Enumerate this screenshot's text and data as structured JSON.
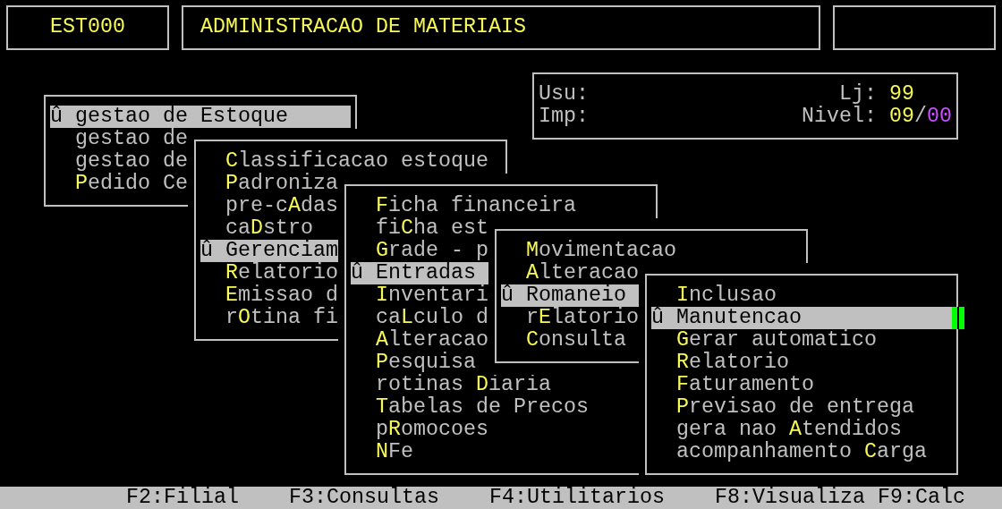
{
  "header": {
    "program_code": "EST000",
    "title": "ADMINISTRACAO DE MATERIAIS"
  },
  "session": {
    "user_label": "Usu:",
    "printer_label": "Imp:",
    "store_label": "Lj:",
    "store": "99",
    "level_label": "Nivel:",
    "level_main": "09",
    "level_separator": "/",
    "level_sub": "00"
  },
  "menus": [
    {
      "items": [
        {
          "marker": "û",
          "text": "gestao de Estoque",
          "selected": true
        },
        {
          "text": "gestao de",
          "selected": false
        },
        {
          "text": "gestao de",
          "selected": false
        },
        {
          "hotkey": "P",
          "rest": "edido Ce",
          "selected": false
        }
      ]
    },
    {
      "items": [
        {
          "hotkey": "C",
          "rest": "lassificacao estoque",
          "selected": false
        },
        {
          "hotkey": "P",
          "rest": "adroniza",
          "selected": false
        },
        {
          "text": "pre-c",
          "hotkey": "A",
          "rest": "das",
          "selected": false
        },
        {
          "text": "ca",
          "hotkey": "D",
          "rest": "stro",
          "selected": false
        },
        {
          "marker": "û",
          "text": "Gerenciam",
          "selected": true
        },
        {
          "hotkey": "R",
          "rest": "elatorio",
          "selected": false
        },
        {
          "hotkey": "E",
          "rest": "missao d",
          "selected": false
        },
        {
          "text": "r",
          "hotkey": "O",
          "rest": "tina fi",
          "selected": false
        }
      ]
    },
    {
      "items": [
        {
          "hotkey": "F",
          "rest": "icha financeira",
          "selected": false
        },
        {
          "text": "fi",
          "hotkey": "C",
          "rest": "ha est",
          "selected": false
        },
        {
          "hotkey": "G",
          "rest": "rade - p",
          "selected": false
        },
        {
          "marker": "û",
          "text": "Entradas",
          "selected": true
        },
        {
          "hotkey": "I",
          "rest": "nventari",
          "selected": false
        },
        {
          "text": "ca",
          "hotkey": "L",
          "rest": "culo d",
          "selected": false
        },
        {
          "hotkey": "A",
          "rest": "lteracao",
          "selected": false
        },
        {
          "hotkey": "P",
          "rest": "esquisa",
          "selected": false
        },
        {
          "text": "rotinas ",
          "hotkey": "D",
          "rest": "iaria",
          "selected": false
        },
        {
          "hotkey": "T",
          "rest": "abelas de Precos",
          "selected": false
        },
        {
          "text": "p",
          "hotkey": "R",
          "rest": "omocoes",
          "selected": false
        },
        {
          "hotkey": "N",
          "rest": "Fe",
          "selected": false
        }
      ]
    },
    {
      "items": [
        {
          "hotkey": "M",
          "rest": "ovimentacao",
          "selected": false
        },
        {
          "hotkey": "A",
          "rest": "lteracao",
          "selected": false
        },
        {
          "marker": "û",
          "text": "Romaneio",
          "selected": true
        },
        {
          "text": "r",
          "hotkey": "E",
          "rest": "latorio",
          "selected": false
        },
        {
          "hotkey": "C",
          "rest": "onsulta",
          "selected": false
        }
      ]
    },
    {
      "items": [
        {
          "hotkey": "I",
          "rest": "nclusao",
          "selected": false
        },
        {
          "marker": "û",
          "text": "Manutencao",
          "selected": true
        },
        {
          "hotkey": "G",
          "rest": "erar automatico",
          "selected": false
        },
        {
          "hotkey": "R",
          "rest": "elatorio",
          "selected": false
        },
        {
          "hotkey": "F",
          "rest": "aturamento",
          "selected": false
        },
        {
          "hotkey": "P",
          "rest": "revisao de entrega",
          "selected": false
        },
        {
          "text": "gera nao ",
          "hotkey": "A",
          "rest": "tendidos",
          "selected": false
        },
        {
          "text": "acompanhamento ",
          "hotkey": "C",
          "rest": "arga",
          "selected": false
        }
      ]
    }
  ],
  "function_keys": [
    "F2:Filial",
    "F3:Consultas",
    "F4:Utilitarios",
    "F8:Visualiza",
    "F9:Calc"
  ]
}
